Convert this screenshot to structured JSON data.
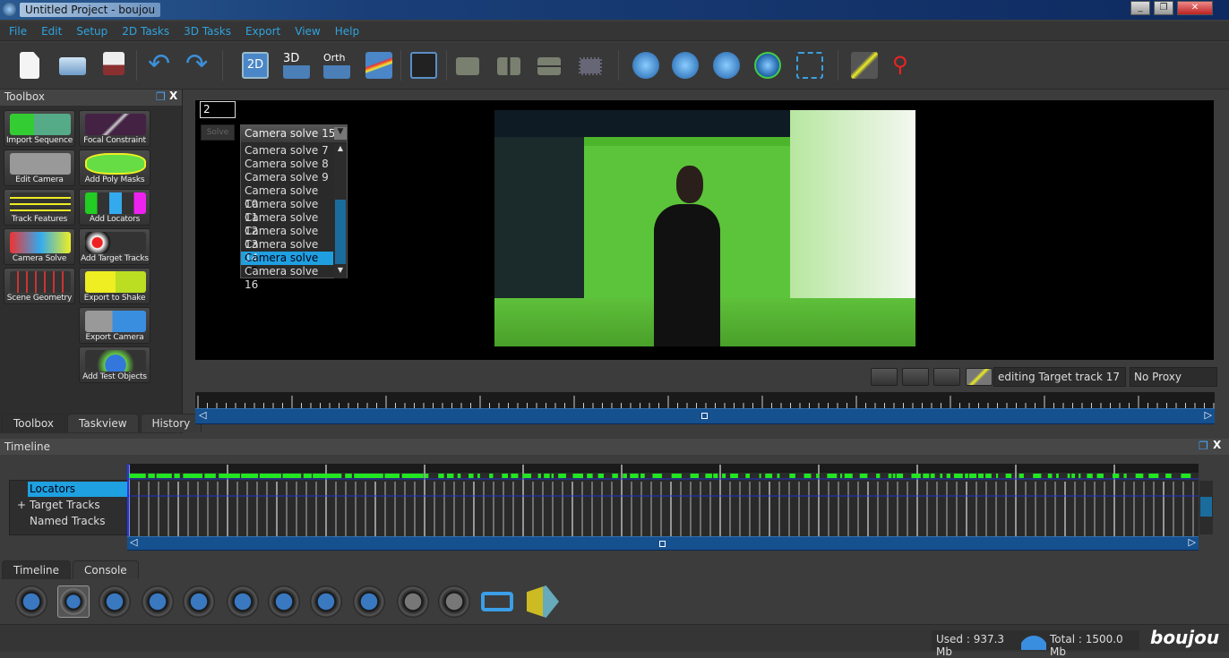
{
  "window": {
    "title": "Untitled Project - boujou",
    "controls": [
      "minimize",
      "restore",
      "close"
    ]
  },
  "menu": [
    "File",
    "Edit",
    "Setup",
    "2D Tasks",
    "3D Tasks",
    "Export",
    "View",
    "Help"
  ],
  "toolbar": {
    "icons": [
      "new-file",
      "open-folder",
      "save",
      "undo",
      "redo",
      "view-2d",
      "view-3d",
      "view-orth",
      "graph-view",
      "layout-grid",
      "layout-single",
      "layout-split-vertical",
      "layout-split-horizontal",
      "layout-quad",
      "camera-track",
      "solve-forward",
      "solve-sphere",
      "solve-refine",
      "frame-select",
      "target-track",
      "pick-tool"
    ],
    "labels": {
      "view2d": "2D",
      "view3d": "3D",
      "orth": "Orth"
    }
  },
  "toolbox": {
    "title": "Toolbox",
    "tools": [
      "Import Sequence",
      "Focal Constraint",
      "Edit Camera",
      "Add Poly Masks",
      "Track Features",
      "Add Locators",
      "Camera Solve",
      "Add Target Tracks",
      "Scene Geometry",
      "Export to Shake",
      "Export Camera",
      "Add Test Objects"
    ],
    "tabs": [
      "Toolbox",
      "Taskview",
      "History"
    ]
  },
  "viewer": {
    "frame_field": "2",
    "solve_button": "Solve",
    "dropdown": {
      "selected": "Camera solve 15",
      "options": [
        "Camera solve 7",
        "Camera solve 8",
        "Camera solve 9",
        "Camera solve 10",
        "Camera solve 11",
        "Camera solve 12",
        "Camera solve 13",
        "Camera solve 14",
        "Camera solve 15",
        "Camera solve 16"
      ]
    },
    "status": "editing Target track 17",
    "proxy": "No Proxy"
  },
  "timeline": {
    "title": "Timeline",
    "tree": [
      "Locators",
      "Target Tracks",
      "Named Tracks"
    ],
    "selected": "Locators",
    "tabs": [
      "Timeline",
      "Console"
    ]
  },
  "transport": [
    "play-backward",
    "stop",
    "play-forward",
    "step-back",
    "step-forward",
    "jump-start",
    "jump-end",
    "prev-key",
    "next-key",
    "prev-disabled",
    "next-disabled",
    "loop",
    "lock-play"
  ],
  "status": {
    "used": "Used : 937.3 Mb",
    "total": "Total : 1500.0 Mb",
    "logo": "boujou"
  },
  "colors": {
    "accent": "#1f9fe0",
    "menu": "#2fa3df",
    "track_green": "#22e622",
    "bar_blue": "#15508f"
  }
}
